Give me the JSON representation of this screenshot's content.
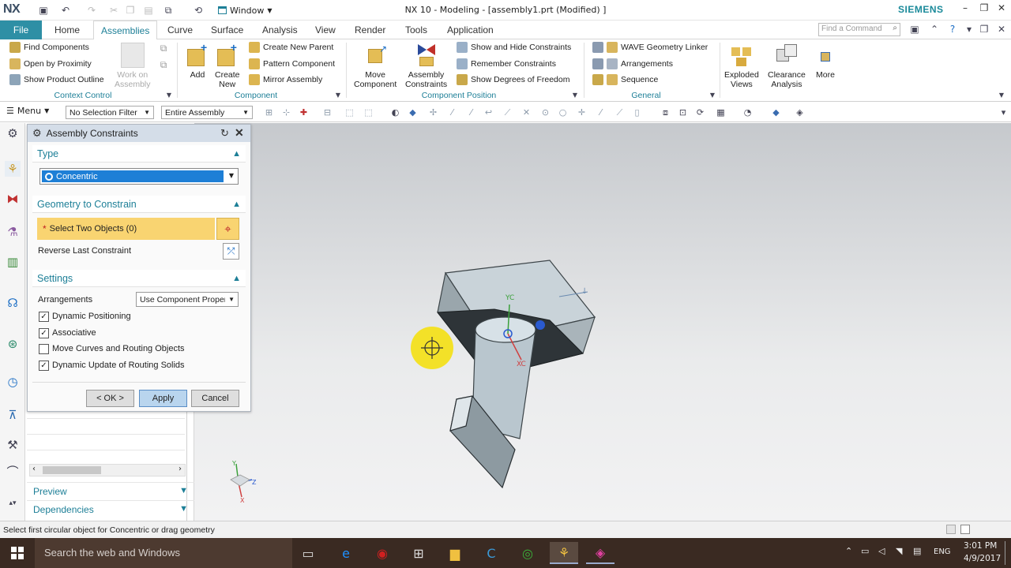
{
  "titlebar": {
    "logo": "NX",
    "window_menu": "Window",
    "doc_title": "NX 10 - Modeling - [assembly1.prt (Modified) ]",
    "brand": "SIEMENS"
  },
  "tabs": {
    "file": "File",
    "items": [
      "Home",
      "Assemblies",
      "Curve",
      "Surface",
      "Analysis",
      "View",
      "Render",
      "Tools",
      "Application"
    ],
    "active": "Assemblies",
    "find_placeholder": "Find a Command"
  },
  "ribbon": {
    "context_control": {
      "label": "Context Control",
      "find_components": "Find Components",
      "open_by_proximity": "Open by Proximity",
      "show_product_outline": "Show Product Outline",
      "work_on_assembly_1": "Work on",
      "work_on_assembly_2": "Assembly"
    },
    "component": {
      "label": "Component",
      "add": "Add",
      "create_new_1": "Create",
      "create_new_2": "New",
      "create_new_parent": "Create New Parent",
      "pattern_component": "Pattern Component",
      "mirror_assembly": "Mirror Assembly"
    },
    "component_position": {
      "label": "Component Position",
      "move_component_1": "Move",
      "move_component_2": "Component",
      "assembly_constraints_1": "Assembly",
      "assembly_constraints_2": "Constraints",
      "show_hide_constraints": "Show and Hide Constraints",
      "remember_constraints": "Remember Constraints",
      "show_dof": "Show Degrees of Freedom"
    },
    "general": {
      "label": "General",
      "wave_linker": "WAVE Geometry Linker",
      "arrangements": "Arrangements",
      "sequence": "Sequence"
    },
    "exploded_1": "Exploded",
    "exploded_2": "Views",
    "clearance_1": "Clearance",
    "clearance_2": "Analysis",
    "more": "More"
  },
  "toolbar": {
    "menu": "Menu",
    "selection_filter": "No Selection Filter",
    "scope": "Entire Assembly"
  },
  "dialog": {
    "title": "Assembly Constraints",
    "type_section": "Type",
    "type_value": "Concentric",
    "geometry_section": "Geometry to Constrain",
    "select_objects": "Select Two Objects (0)",
    "reverse_last": "Reverse Last Constraint",
    "settings_section": "Settings",
    "arrangements_label": "Arrangements",
    "arrangements_value": "Use Component Properties",
    "options": [
      {
        "label": "Dynamic Positioning",
        "checked": true
      },
      {
        "label": "Associative",
        "checked": true
      },
      {
        "label": "Move Curves and Routing Objects",
        "checked": false
      },
      {
        "label": "Dynamic Update of Routing Solids",
        "checked": true
      }
    ],
    "ok": "< OK >",
    "apply": "Apply",
    "cancel": "Cancel"
  },
  "navigator": {
    "preview": "Preview",
    "dependencies": "Dependencies"
  },
  "viewport": {
    "yc": "YC",
    "xc": "XC",
    "triad_y": "Y",
    "triad_z": "Z",
    "triad_x": "X"
  },
  "status": {
    "prompt": "Select first circular object for Concentric or drag geometry"
  },
  "taskbar": {
    "search": "Search the web and Windows",
    "lang": "ENG",
    "time": "3:01 PM",
    "date": "4/9/2017"
  },
  "colors": {
    "accent": "#1d7f97",
    "file_tab": "#2e8fa5",
    "selection_highlight": "#f9d471",
    "type_selected": "#1e7fd6"
  }
}
